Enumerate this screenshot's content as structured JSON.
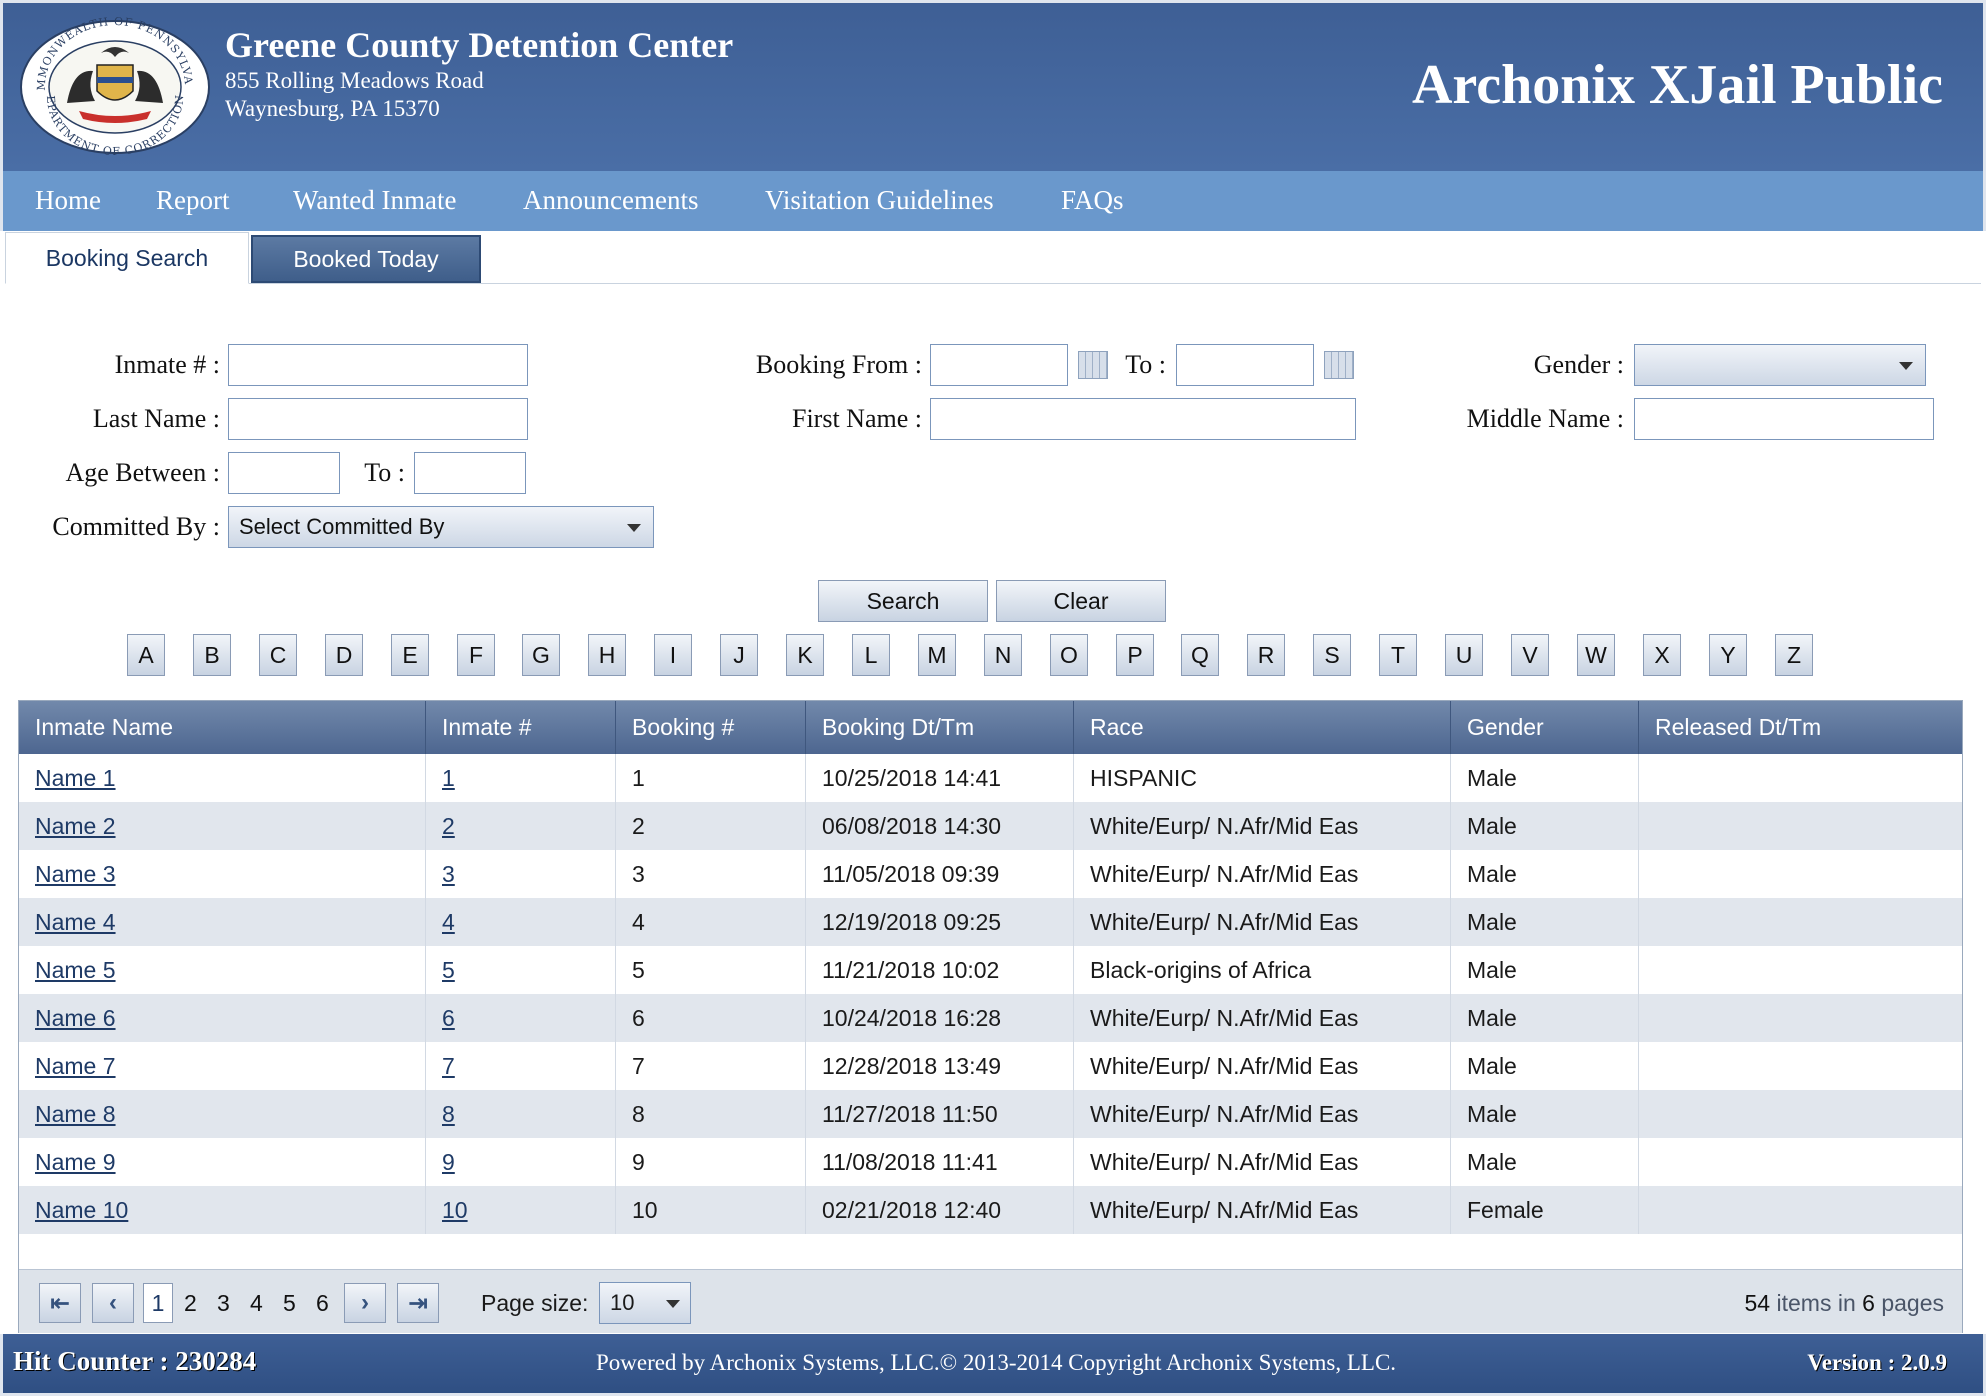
{
  "header": {
    "seal_text_top": "COMMONWEALTH OF PENNSYLVANIA",
    "seal_text_bottom": "DEPARTMENT OF CORRECTIONS",
    "agency_name": "Greene County Detention Center",
    "address_line1": "855 Rolling Meadows Road",
    "address_line2": "Waynesburg, PA 15370",
    "product_name": "Archonix XJail Public"
  },
  "nav": {
    "items": [
      "Home",
      "Report",
      "Wanted Inmate",
      "Announcements",
      "Visitation Guidelines",
      "FAQs"
    ]
  },
  "tabs": {
    "booking_search": "Booking Search",
    "booked_today": "Booked Today"
  },
  "form": {
    "inmate_no_label": "Inmate # :",
    "last_name_label": "Last Name :",
    "age_between_label": "Age Between :",
    "age_to_label": "To :",
    "committed_by_label": "Committed By :",
    "committed_by_value": "Select Committed By",
    "booking_from_label": "Booking From :",
    "booking_to_label": "To :",
    "first_name_label": "First Name :",
    "gender_label": "Gender :",
    "gender_value": "",
    "middle_name_label": "Middle Name :",
    "search_button": "Search",
    "clear_button": "Clear"
  },
  "alphabet": [
    "A",
    "B",
    "C",
    "D",
    "E",
    "F",
    "G",
    "H",
    "I",
    "J",
    "K",
    "L",
    "M",
    "N",
    "O",
    "P",
    "Q",
    "R",
    "S",
    "T",
    "U",
    "V",
    "W",
    "X",
    "Y",
    "Z"
  ],
  "grid": {
    "columns": [
      "Inmate Name",
      "Inmate #",
      "Booking #",
      "Booking Dt/Tm",
      "Race",
      "Gender",
      "Released Dt/Tm"
    ],
    "rows": [
      {
        "name": "Name 1",
        "inmate_no": "1",
        "booking_no": "1",
        "booking_dt": "10/25/2018 14:41",
        "race": "HISPANIC",
        "gender": "Male",
        "released": ""
      },
      {
        "name": "Name 2",
        "inmate_no": "2",
        "booking_no": "2",
        "booking_dt": "06/08/2018 14:30",
        "race": "White/Eurp/ N.Afr/Mid Eas",
        "gender": "Male",
        "released": ""
      },
      {
        "name": "Name 3",
        "inmate_no": "3",
        "booking_no": "3",
        "booking_dt": "11/05/2018 09:39",
        "race": "White/Eurp/ N.Afr/Mid Eas",
        "gender": "Male",
        "released": ""
      },
      {
        "name": "Name 4",
        "inmate_no": "4",
        "booking_no": "4",
        "booking_dt": "12/19/2018 09:25",
        "race": "White/Eurp/ N.Afr/Mid Eas",
        "gender": "Male",
        "released": ""
      },
      {
        "name": "Name 5",
        "inmate_no": "5",
        "booking_no": "5",
        "booking_dt": "11/21/2018 10:02",
        "race": "Black-origins of Africa",
        "gender": "Male",
        "released": ""
      },
      {
        "name": "Name 6",
        "inmate_no": "6",
        "booking_no": "6",
        "booking_dt": "10/24/2018 16:28",
        "race": "White/Eurp/ N.Afr/Mid Eas",
        "gender": "Male",
        "released": ""
      },
      {
        "name": "Name 7",
        "inmate_no": "7",
        "booking_no": "7",
        "booking_dt": "12/28/2018 13:49",
        "race": "White/Eurp/ N.Afr/Mid Eas",
        "gender": "Male",
        "released": ""
      },
      {
        "name": "Name 8",
        "inmate_no": "8",
        "booking_no": "8",
        "booking_dt": "11/27/2018 11:50",
        "race": "White/Eurp/ N.Afr/Mid Eas",
        "gender": "Male",
        "released": ""
      },
      {
        "name": "Name 9",
        "inmate_no": "9",
        "booking_no": "9",
        "booking_dt": "11/08/2018 11:41",
        "race": "White/Eurp/ N.Afr/Mid Eas",
        "gender": "Male",
        "released": ""
      },
      {
        "name": "Name 10",
        "inmate_no": "10",
        "booking_no": "10",
        "booking_dt": "02/21/2018 12:40",
        "race": "White/Eurp/ N.Afr/Mid Eas",
        "gender": "Female",
        "released": ""
      }
    ]
  },
  "pager": {
    "pages": [
      "1",
      "2",
      "3",
      "4",
      "5",
      "6"
    ],
    "current_page": "1",
    "page_size_label": "Page size:",
    "page_size_value": "10",
    "total_items": "54",
    "items_in_text": "items in",
    "total_pages": "6",
    "pages_text": "pages"
  },
  "footer": {
    "hit_counter": "Hit Counter : 230284",
    "powered_by": "Powered by Archonix Systems, LLC.© 2013-2014 Copyright Archonix Systems, LLC.",
    "version": "Version : 2.0.9"
  },
  "colors": {
    "header_bg": "#3e5f95",
    "nav_bg": "#6a98cc",
    "grid_header_bg": "#4d6690",
    "row_alt_bg": "#e1e6ed",
    "link": "#1e3a66"
  },
  "icons": [
    "state-seal-icon",
    "calendar-icon",
    "chevron-down-icon",
    "first-page-icon",
    "prev-page-icon",
    "next-page-icon",
    "last-page-icon"
  ]
}
